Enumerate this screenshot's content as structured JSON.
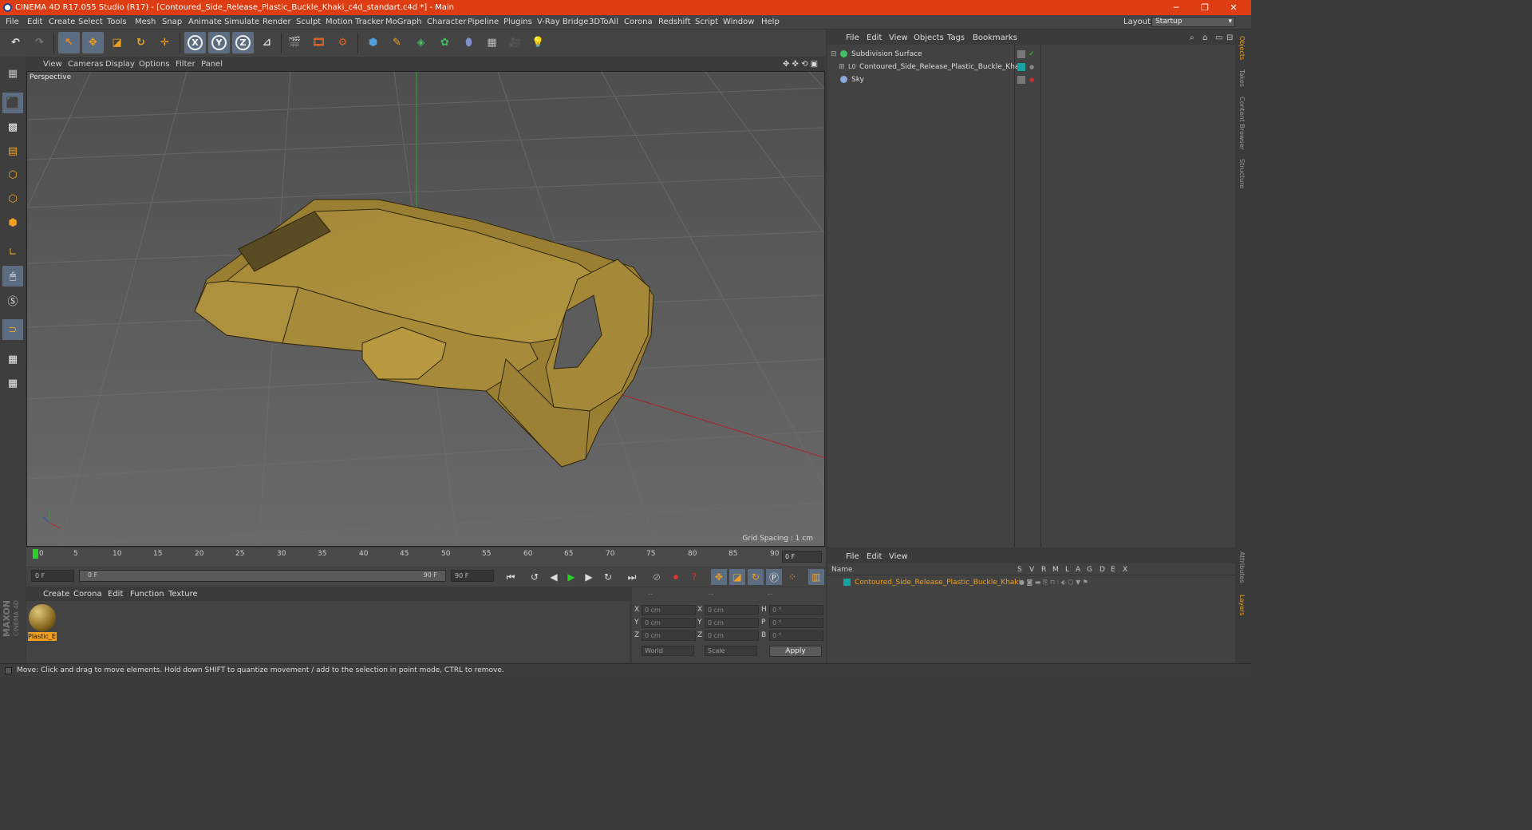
{
  "window": {
    "title": "CINEMA 4D R17.055 Studio (R17) - [Contoured_Side_Release_Plastic_Buckle_Khaki_c4d_standart.c4d *] - Main",
    "minimize": "─",
    "restore": "❐",
    "close": "✕"
  },
  "menu": [
    "File",
    "Edit",
    "Create",
    "Select",
    "Tools",
    "Mesh",
    "Snap",
    "Animate",
    "Simulate",
    "Render",
    "Sculpt",
    "Motion Tracker",
    "MoGraph",
    "Character",
    "Pipeline",
    "Plugins",
    "V-Ray Bridge",
    "3DToAll",
    "Corona",
    "Redshift",
    "Script",
    "Window",
    "Help"
  ],
  "layout": {
    "label": "Layout:",
    "value": "Startup"
  },
  "toolbar": {
    "x": "X",
    "y": "Y",
    "z": "Z"
  },
  "viewport": {
    "menu": [
      "View",
      "Cameras",
      "Display",
      "Options",
      "Filter",
      "Panel"
    ],
    "label": "Perspective",
    "grid_spacing": "Grid Spacing : 1 cm"
  },
  "timeline": {
    "ticks": [
      "0",
      "5",
      "10",
      "15",
      "20",
      "25",
      "30",
      "35",
      "40",
      "45",
      "50",
      "55",
      "60",
      "65",
      "70",
      "75",
      "80",
      "85",
      "90"
    ],
    "frame_field": "0 F"
  },
  "playbar": {
    "start": "0 F",
    "range_start": "0 F",
    "range_end": "90 F",
    "end": "90 F"
  },
  "material_manager": {
    "menu": [
      "Create",
      "Corona",
      "Edit",
      "Function",
      "Texture"
    ],
    "materials": [
      {
        "name": "Plastic_E"
      }
    ]
  },
  "coords": {
    "headers": [
      "--",
      "--",
      "--"
    ],
    "rows": [
      {
        "a": "X",
        "av": "0 cm",
        "b": "X",
        "bv": "0 cm",
        "c": "H",
        "cv": "0 °"
      },
      {
        "a": "Y",
        "av": "0 cm",
        "b": "Y",
        "bv": "0 cm",
        "c": "P",
        "cv": "0 °"
      },
      {
        "a": "Z",
        "av": "0 cm",
        "b": "Z",
        "bv": "0 cm",
        "c": "B",
        "cv": "0 °"
      }
    ],
    "mode": "World",
    "scale": "Scale",
    "apply": "Apply"
  },
  "object_manager": {
    "menu": [
      "File",
      "Edit",
      "View",
      "Objects",
      "Tags",
      "Bookmarks"
    ],
    "objects": [
      {
        "name": "Subdivision Surface"
      },
      {
        "name": "Contoured_Side_Release_Plastic_Buckle_Khaki"
      },
      {
        "name": "Sky"
      }
    ]
  },
  "layer_manager": {
    "menu": [
      "File",
      "Edit",
      "View"
    ],
    "columns": [
      "Name",
      "S",
      "V",
      "R",
      "M",
      "L",
      "A",
      "G",
      "D",
      "E",
      "X"
    ],
    "layers": [
      {
        "name": "Contoured_Side_Release_Plastic_Buckle_Khaki"
      }
    ]
  },
  "side_tabs": [
    "Objects",
    "Takes",
    "Content Browser",
    "Structure"
  ],
  "side_tabs_bottom": [
    "Attributes",
    "Layers"
  ],
  "brand": {
    "maxon": "MAXON",
    "product": "CINEMA 4D"
  },
  "status": "Move: Click and drag to move elements. Hold down SHIFT to quantize movement / add to the selection in point mode, CTRL to remove.",
  "colors": {
    "title_bar": "#de3d13",
    "layer_highlight": "#f0a020",
    "model": "#a8893a",
    "teal_tag": "#16a3a3"
  }
}
